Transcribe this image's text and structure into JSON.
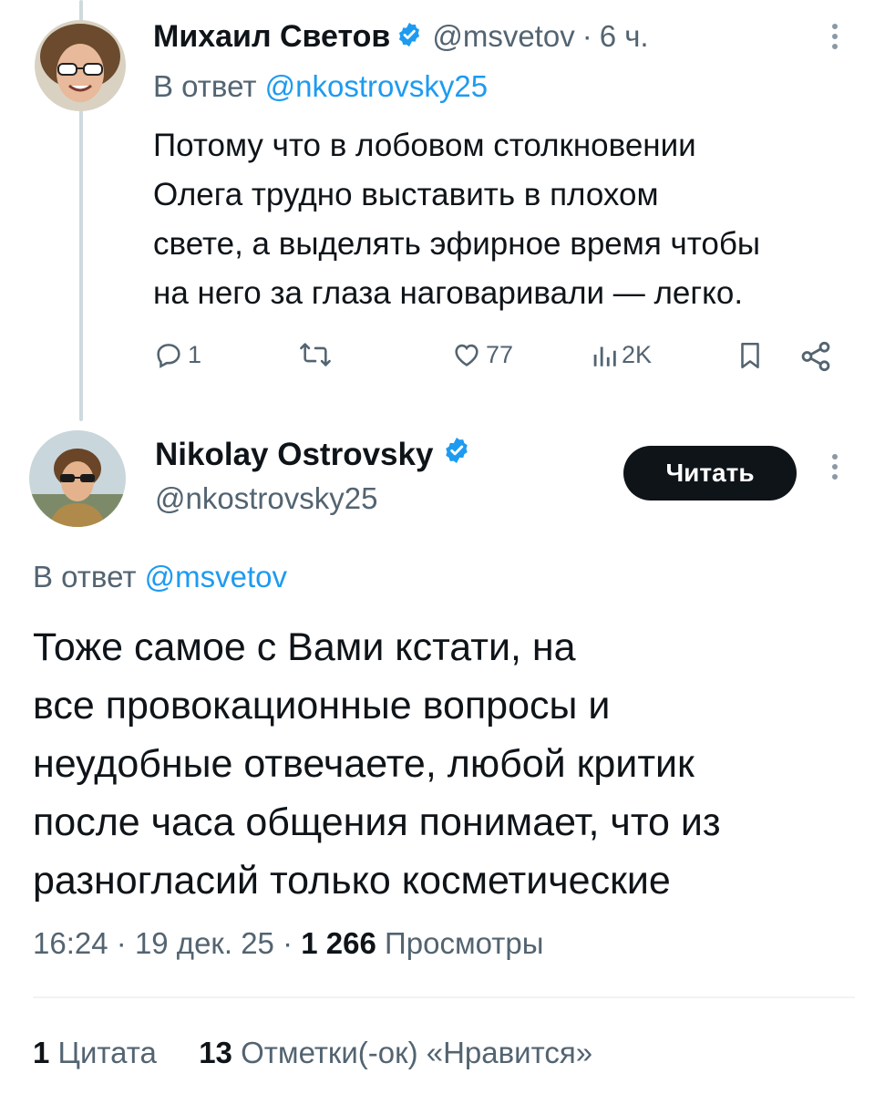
{
  "colors": {
    "text_primary": "#0f1419",
    "text_secondary": "#536471",
    "link": "#1d9bf0",
    "verified": "#1d9bf0",
    "button_bg": "#0f1419",
    "button_text": "#ffffff",
    "thread_line": "#cfd9de"
  },
  "parent_tweet": {
    "author_name": "Михаил Светов",
    "handle": "@msvetov",
    "time": "6 ч.",
    "separator": "·",
    "reply_prefix": "В ответ",
    "reply_to": "@nkostrovsky25",
    "text": "Потому что в лобовом столкновении\nОлега трудно выставить в плохом\nсвете, а выделять эфирное время чтобы\nна него за глаза наговаривали — легко.",
    "replies": "1",
    "retweets": "",
    "likes": "77",
    "views": "2K",
    "icons": [
      "reply-icon",
      "retweet-icon",
      "like-icon",
      "views-icon",
      "bookmark-icon",
      "share-icon",
      "more-icon",
      "verified-icon"
    ]
  },
  "main_tweet": {
    "author_name": "Nikolay Ostrovsky",
    "handle": "@nkostrovsky25",
    "follow_label": "Читать",
    "reply_prefix": "В ответ",
    "reply_to": "@msvetov",
    "text": "Тоже самое с Вами кстати, на\nвсе провокационные вопросы и\nнеудобные отвечаете, любой критик\nпосле часа общения понимает, что из\nразногласий только косметические",
    "time": "16:24",
    "date": "19 дек. 25",
    "separator": "·",
    "views_count": "1 266",
    "views_label": "Просмотры",
    "quotes_count": "1",
    "quotes_label": "Цитата",
    "likes_count": "13",
    "likes_label": "Отметки(-ок) «Нравится»"
  }
}
